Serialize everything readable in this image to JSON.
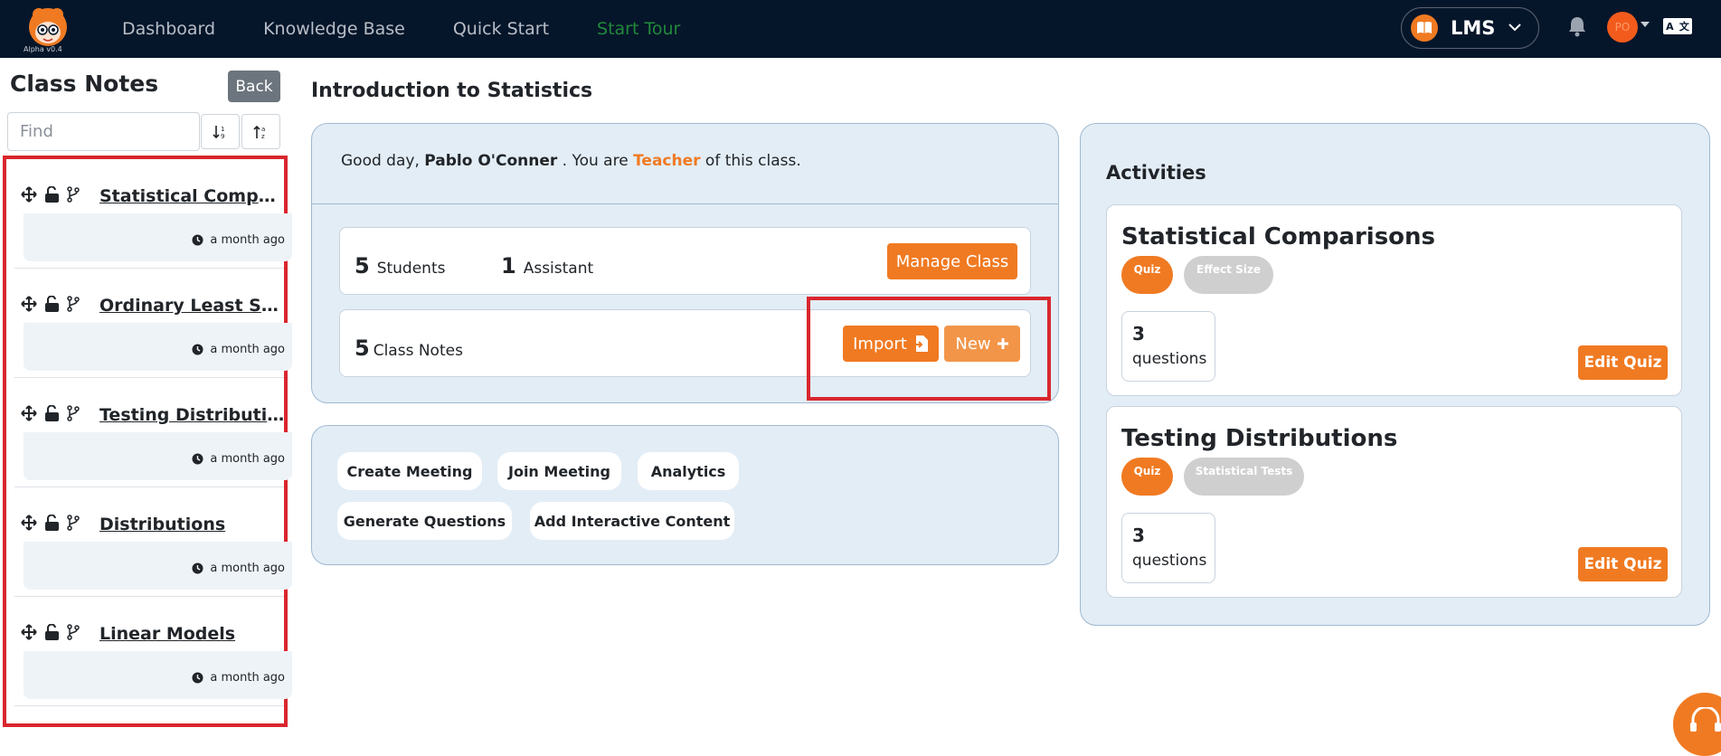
{
  "nav": {
    "logo_version": "Alpha v0.4",
    "links": [
      "Dashboard",
      "Knowledge Base",
      "Quick Start",
      "Start Tour"
    ],
    "app_switch_label": "LMS",
    "avatar_initials": "PO",
    "lang_icon": "translate-icon"
  },
  "sidebar": {
    "title": "Class Notes",
    "back_label": "Back",
    "find_placeholder": "Find",
    "notes": [
      {
        "title": "Statistical Comparisons",
        "time": "a month ago"
      },
      {
        "title": "Ordinary Least Squares",
        "time": "a month ago"
      },
      {
        "title": "Testing Distributions",
        "time": "a month ago"
      },
      {
        "title": "Distributions",
        "time": "a month ago"
      },
      {
        "title": "Linear Models",
        "time": "a month ago"
      }
    ]
  },
  "main": {
    "title": "Introduction to Statistics",
    "greeting": {
      "prefix": "Good day,",
      "name": "Pablo O'Conner",
      "mid": ". You are",
      "role": "Teacher",
      "suffix": "of this class."
    },
    "students_count": "5",
    "students_label": "Students",
    "assistants_count": "1",
    "assistants_label": "Assistant",
    "manage_label": "Manage Class",
    "notes_count": "5",
    "notes_label": "Class Notes",
    "import_label": "Import",
    "new_label": "New",
    "actions": [
      "Create Meeting",
      "Join Meeting",
      "Analytics",
      "Generate Questions",
      "Add Interactive Content"
    ]
  },
  "activities": {
    "title": "Activities",
    "items": [
      {
        "name": "Statistical Comparisons",
        "type": "Quiz",
        "topic": "Effect Size",
        "questions": "3",
        "questions_label": "questions",
        "edit_label": "Edit Quiz"
      },
      {
        "name": "Testing Distributions",
        "type": "Quiz",
        "topic": "Statistical Tests",
        "questions": "3",
        "questions_label": "questions",
        "edit_label": "Edit Quiz"
      }
    ]
  },
  "colors": {
    "accent": "#f07a22",
    "nav_bg": "#06162a",
    "highlight": "#d9262d",
    "card_bg": "#e3edf6"
  }
}
